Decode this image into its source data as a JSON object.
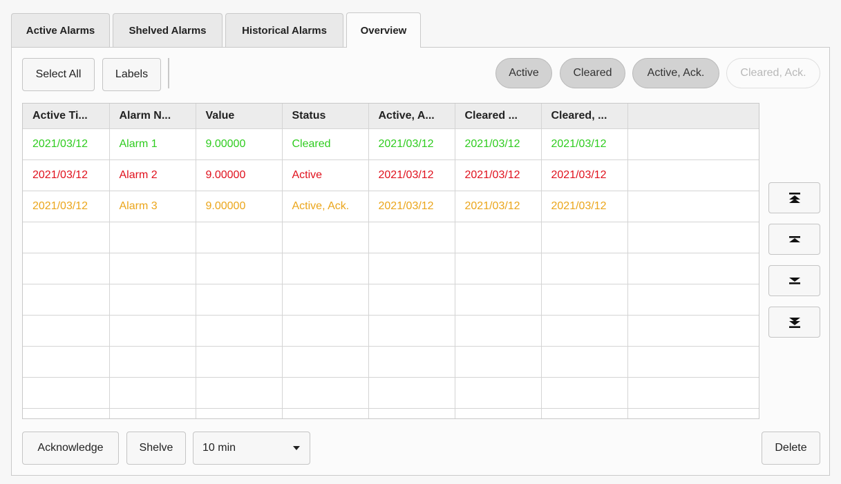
{
  "tabs": [
    {
      "label": "Active Alarms"
    },
    {
      "label": "Shelved Alarms"
    },
    {
      "label": "Historical Alarms"
    },
    {
      "label": "Overview",
      "active": true
    }
  ],
  "toolbar": {
    "select_all_label": "Select All",
    "labels_label": "Labels"
  },
  "filters": [
    {
      "label": "Active",
      "enabled": true
    },
    {
      "label": "Cleared",
      "enabled": true
    },
    {
      "label": "Active, Ack.",
      "enabled": true
    },
    {
      "label": "Cleared, Ack.",
      "enabled": false
    }
  ],
  "table": {
    "columns": [
      "Active Ti...",
      "Alarm N...",
      "Value",
      "Status",
      "Active, A...",
      "Cleared ...",
      "Cleared, ...",
      ""
    ],
    "rows": [
      {
        "status_color": "#2ecc1e",
        "cells": [
          "2021/03/12",
          "Alarm 1",
          "9.00000",
          "Cleared",
          "2021/03/12",
          "2021/03/12",
          "2021/03/12",
          ""
        ]
      },
      {
        "status_color": "#e0101c",
        "cells": [
          "2021/03/12",
          "Alarm 2",
          "9.00000",
          "Active",
          "2021/03/12",
          "2021/03/12",
          "2021/03/12",
          ""
        ]
      },
      {
        "status_color": "#eba51a",
        "cells": [
          "2021/03/12",
          "Alarm 3",
          "9.00000",
          "Active, Ack.",
          "2021/03/12",
          "2021/03/12",
          "2021/03/12",
          ""
        ]
      }
    ],
    "empty_rows": 7
  },
  "scroll_buttons": [
    {
      "icon": "scroll-top-icon"
    },
    {
      "icon": "page-up-icon"
    },
    {
      "icon": "page-down-icon"
    },
    {
      "icon": "scroll-bottom-icon"
    }
  ],
  "footer": {
    "acknowledge_label": "Acknowledge",
    "shelve_label": "Shelve",
    "shelve_duration": "10 min",
    "delete_label": "Delete"
  }
}
